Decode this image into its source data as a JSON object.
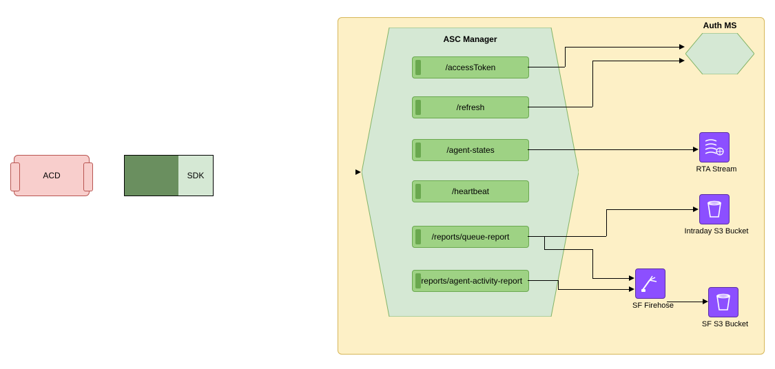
{
  "acd": {
    "label": "ACD"
  },
  "sdk": {
    "label": "SDK"
  },
  "asc": {
    "title": "ASC Manager",
    "endpoints": [
      "/accessToken",
      "/refresh",
      "/agent-states",
      "/heartbeat",
      "/reports/queue-report",
      "/reports/agent-activity-report"
    ]
  },
  "services": {
    "auth": {
      "label": "Auth MS"
    },
    "rta": {
      "label": "RTA Stream"
    },
    "intraday": {
      "label": "Intraday S3 Bucket"
    },
    "firehose": {
      "label": "SF Firehose"
    },
    "sfbucket": {
      "label": "SF S3 Bucket"
    }
  },
  "colors": {
    "panel_bg": "#fdf0c6",
    "panel_border": "#d6b656",
    "asc_bg": "#d5e8d4",
    "asc_border": "#82b366",
    "ep_bg": "#9ed284",
    "ep_border": "#6aa84f",
    "acd_bg": "#f8cecc",
    "acd_border": "#b85450",
    "aws": "#8c4fff"
  }
}
